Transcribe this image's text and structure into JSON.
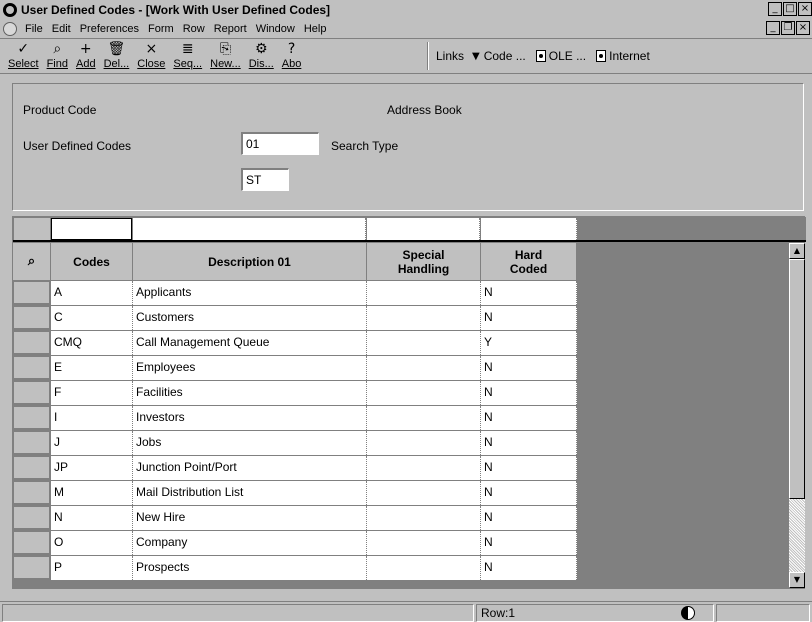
{
  "window": {
    "title": "User Defined Codes - [Work With User Defined Codes]",
    "buttons": {
      "minimize": "_",
      "maximize": "□",
      "close": "×"
    }
  },
  "menu": {
    "items": [
      "File",
      "Edit",
      "Preferences",
      "Form",
      "Row",
      "Report",
      "Window",
      "Help"
    ],
    "mdi_buttons": {
      "minimize": "_",
      "restore": "❐",
      "close": "×"
    }
  },
  "toolbar": {
    "buttons": [
      {
        "label": "Select",
        "icon": "check-icon",
        "glyph": "✓"
      },
      {
        "label": "Find",
        "icon": "find-icon",
        "glyph": "⌕"
      },
      {
        "label": "Add",
        "icon": "add-icon",
        "glyph": "+"
      },
      {
        "label": "Del...",
        "icon": "trash-icon",
        "glyph": "🗑"
      },
      {
        "label": "Close",
        "icon": "close-icon",
        "glyph": "×"
      },
      {
        "label": "Seq...",
        "icon": "sequence-icon",
        "glyph": "≣"
      },
      {
        "label": "New...",
        "icon": "new-icon",
        "glyph": "⎘"
      },
      {
        "label": "Dis...",
        "icon": "display-icon",
        "glyph": "⚙"
      },
      {
        "label": "Abo",
        "icon": "about-icon",
        "glyph": "?"
      }
    ],
    "links_label": "Links",
    "code_label": "Code ...",
    "ole_label": "OLE ...",
    "internet_label": "Internet"
  },
  "header": {
    "product_code_label": "Product Code",
    "product_code_value": "01",
    "product_code_desc": "Address Book",
    "udc_label": "User Defined Codes",
    "udc_value": "ST",
    "udc_desc": "Search Type"
  },
  "grid": {
    "columns": [
      "Codes",
      "Description 01",
      "Special Handling",
      "Hard Coded"
    ],
    "rows": [
      {
        "code": "A",
        "desc": "Applicants",
        "special": "",
        "hard": "N"
      },
      {
        "code": "C",
        "desc": "Customers",
        "special": "",
        "hard": "N"
      },
      {
        "code": "CMQ",
        "desc": "Call Management Queue",
        "special": "",
        "hard": "Y"
      },
      {
        "code": "E",
        "desc": "Employees",
        "special": "",
        "hard": "N"
      },
      {
        "code": "F",
        "desc": "Facilities",
        "special": "",
        "hard": "N"
      },
      {
        "code": "I",
        "desc": "Investors",
        "special": "",
        "hard": "N"
      },
      {
        "code": "J",
        "desc": "Jobs",
        "special": "",
        "hard": "N"
      },
      {
        "code": "JP",
        "desc": "Junction Point/Port",
        "special": "",
        "hard": "N"
      },
      {
        "code": "M",
        "desc": "Mail Distribution List",
        "special": "",
        "hard": "N"
      },
      {
        "code": "N",
        "desc": "New Hire",
        "special": "",
        "hard": "N"
      },
      {
        "code": "O",
        "desc": "Company",
        "special": "",
        "hard": "N"
      },
      {
        "code": "P",
        "desc": "Prospects",
        "special": "",
        "hard": "N"
      }
    ]
  },
  "status": {
    "row_text": "Row:1"
  },
  "colors": {
    "face": "#c0c0c0",
    "shadow": "#808080",
    "highlight": "#ffffff"
  }
}
